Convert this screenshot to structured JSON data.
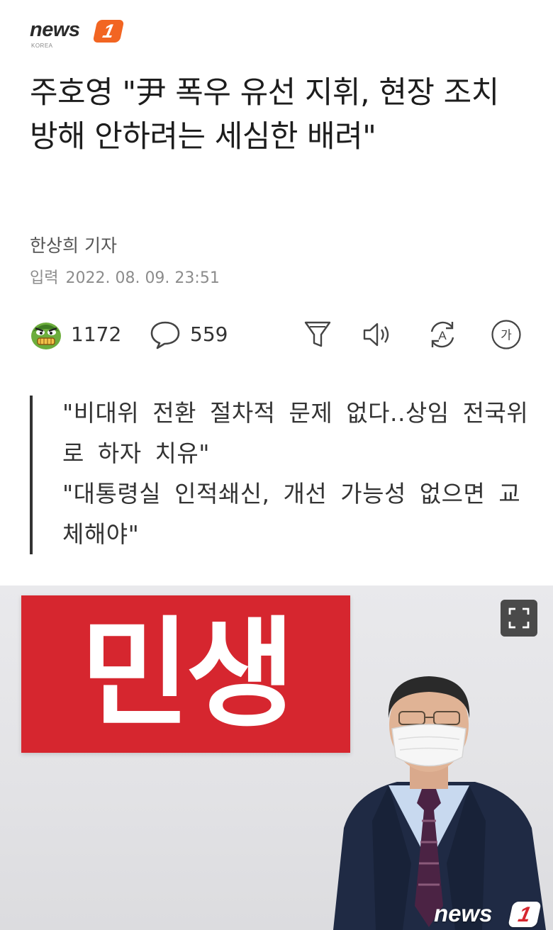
{
  "brand": {
    "logo_word": "news",
    "logo_badge": "1",
    "logo_sub": "KOREA"
  },
  "article": {
    "headline": "주호영 \"尹 폭우 유선 지휘, 현장 조치 방해 안하려는 세심한 배려\"",
    "reporter": "한상희 기자",
    "published_label": "입력",
    "published_at": "2022. 08. 09. 23:51"
  },
  "actions": {
    "reaction_count": "1172",
    "comment_count": "559",
    "icons": [
      "angry-face-icon",
      "comment-icon",
      "filter-icon",
      "speaker-icon",
      "translate-icon",
      "font-size-icon"
    ],
    "font_size_glyph": "가",
    "translate_glyph": "A"
  },
  "summary": [
    "\"비대위 전환 절차적 문제 없다..상임 전국위로 하자 치유\"",
    "\"대통령실 인적쇄신, 개선 가능성 없으면 교체해야\""
  ],
  "photo": {
    "sign_text": "민생",
    "watermark_word": "news",
    "watermark_badge": "1",
    "colors": {
      "sign": "#d6262f",
      "brand_orange": "#f26522"
    }
  }
}
